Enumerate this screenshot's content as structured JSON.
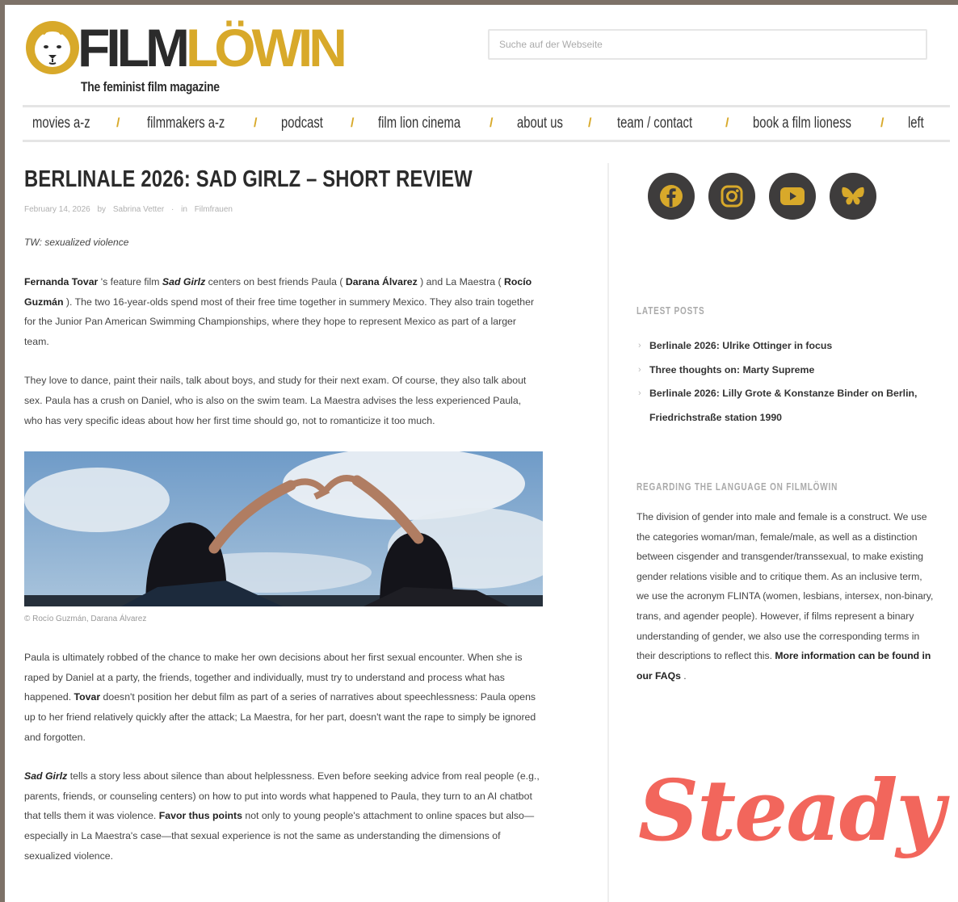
{
  "header": {
    "logo_film": "FILM",
    "logo_lowin": "LÖWIN",
    "tagline": "The feminist film magazine",
    "search_placeholder": "Suche auf der Webseite"
  },
  "nav": {
    "items": [
      "movies a-z",
      "filmmakers a-z",
      "podcast",
      "film lion cinema",
      "about us",
      "team / contact",
      "book a film lioness",
      "left"
    ],
    "separator": "/"
  },
  "article": {
    "title": "BERLINALE 2026: SAD GIRLZ – SHORT REVIEW",
    "meta": {
      "date": "February 14, 2026",
      "by": "by",
      "author": "Sabrina Vetter",
      "dot": "·",
      "in": "in",
      "category": "Filmfrauen"
    },
    "trigger_warning": "TW: sexualized violence",
    "p1": {
      "director": "Fernanda Tovar",
      "t1": " 's feature film ",
      "film": "Sad Girlz",
      "t2": " centers on best friends Paula ( ",
      "actor1": "Darana Álvarez",
      "t3": " ) and La Maestra ( ",
      "actor2": "Rocío Guzmán",
      "t4": " ). The two 16-year-olds spend most of their free time together in summery Mexico. They also train together for the Junior Pan American Swimming Championships, where they hope to represent Mexico as part of a larger team."
    },
    "p2": "They love to dance, paint their nails, talk about boys, and study for their next exam. Of course, they also talk about sex. Paula has a crush on Daniel, who is also on the swim team. La Maestra advises the less experienced Paula, who has very specific ideas about how her first time should go, not to romanticize it too much.",
    "image_caption": "© Rocío Guzmán, Darana Álvarez",
    "p3": {
      "t1": "Paula is ultimately robbed of the chance to make her own decisions about her first sexual encounter. When she is raped by Daniel at a party, the friends, together and individually, must try to understand and process what has happened. ",
      "director": "Tovar",
      "t2": " doesn't position her debut film as part of a series of narratives about speechlessness: Paula opens up to her friend relatively quickly after the attack; La Maestra, for her part, doesn't want the rape to simply be ignored and forgotten."
    },
    "p4": {
      "film": "Sad Girlz",
      "t1": " tells a story less about silence than about helplessness. Even before seeking advice from real people (e.g., parents, friends, or counseling centers) on how to put into words what happened to Paula, they turn to an AI chatbot that tells them it was violence. ",
      "highlight": "Favor thus points",
      "t2": " not only to young people's attachment to online spaces but also—especially in La Maestra's case—that sexual experience is not the same as understanding the dimensions of sexualized violence."
    }
  },
  "sidebar": {
    "social": [
      "facebook-icon",
      "instagram-icon",
      "youtube-icon",
      "butterfly-icon"
    ],
    "latest_heading": "LATEST POSTS",
    "latest_posts": [
      "Berlinale 2026: Ulrike Ottinger in focus",
      "Three thoughts on: Marty Supreme",
      "Berlinale 2026: Lilly Grote & Konstanze Binder on Berlin, Friedrichstraße station 1990"
    ],
    "bullet": "›",
    "regarding_heading": "REGARDING THE LANGUAGE ON FILMLÖWIN",
    "regarding_text": "The division of gender into male and female is a construct. We use the categories woman/man, female/male, as well as a distinction between cisgender and transgender/transsexual, to make existing gender relations visible and to critique them. As an inclusive term, we use the acronym FLINTA (women, lesbians, intersex, non-binary, trans, and agender people). However, if films represent a binary understanding of gender, we also use the corresponding terms in their descriptions to reflect this. ",
    "regarding_link": "More information can be found in our FAQs",
    "regarding_end": " .",
    "steady_label": "Steady"
  },
  "colors": {
    "accent": "#d8a92a",
    "dark": "#2b2b2b",
    "social_bg": "#3e3c3c",
    "steady": "#f2665c"
  }
}
